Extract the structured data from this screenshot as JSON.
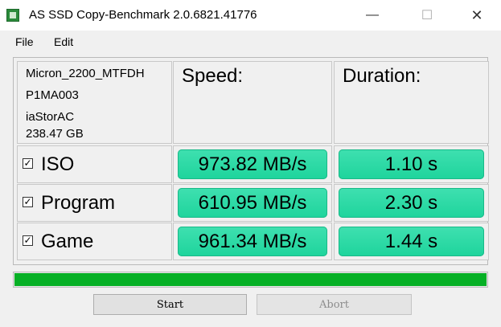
{
  "window": {
    "title": "AS SSD Copy-Benchmark 2.0.6821.41776",
    "min_icon": "minimize-icon",
    "max_icon": "maximize-icon",
    "close_icon": "close-icon"
  },
  "menu": {
    "items": [
      "File",
      "Edit"
    ]
  },
  "drive": {
    "model": "Micron_2200_MTFDH",
    "firmware": "P1MA003",
    "driver": "iaStorAC",
    "size": "238.47 GB"
  },
  "headers": {
    "speed": "Speed:",
    "duration": "Duration:"
  },
  "rows": [
    {
      "label": "ISO",
      "checked": true,
      "speed": "973.82 MB/s",
      "duration": "1.10 s"
    },
    {
      "label": "Program",
      "checked": true,
      "speed": "610.95 MB/s",
      "duration": "2.30 s"
    },
    {
      "label": "Game",
      "checked": true,
      "speed": "961.34 MB/s",
      "duration": "1.44 s"
    }
  ],
  "progress": {
    "fraction": 1.0,
    "color": "#06b025"
  },
  "buttons": {
    "start": "Start",
    "abort": "Abort"
  },
  "colors": {
    "result_green": "#1ed49c"
  }
}
